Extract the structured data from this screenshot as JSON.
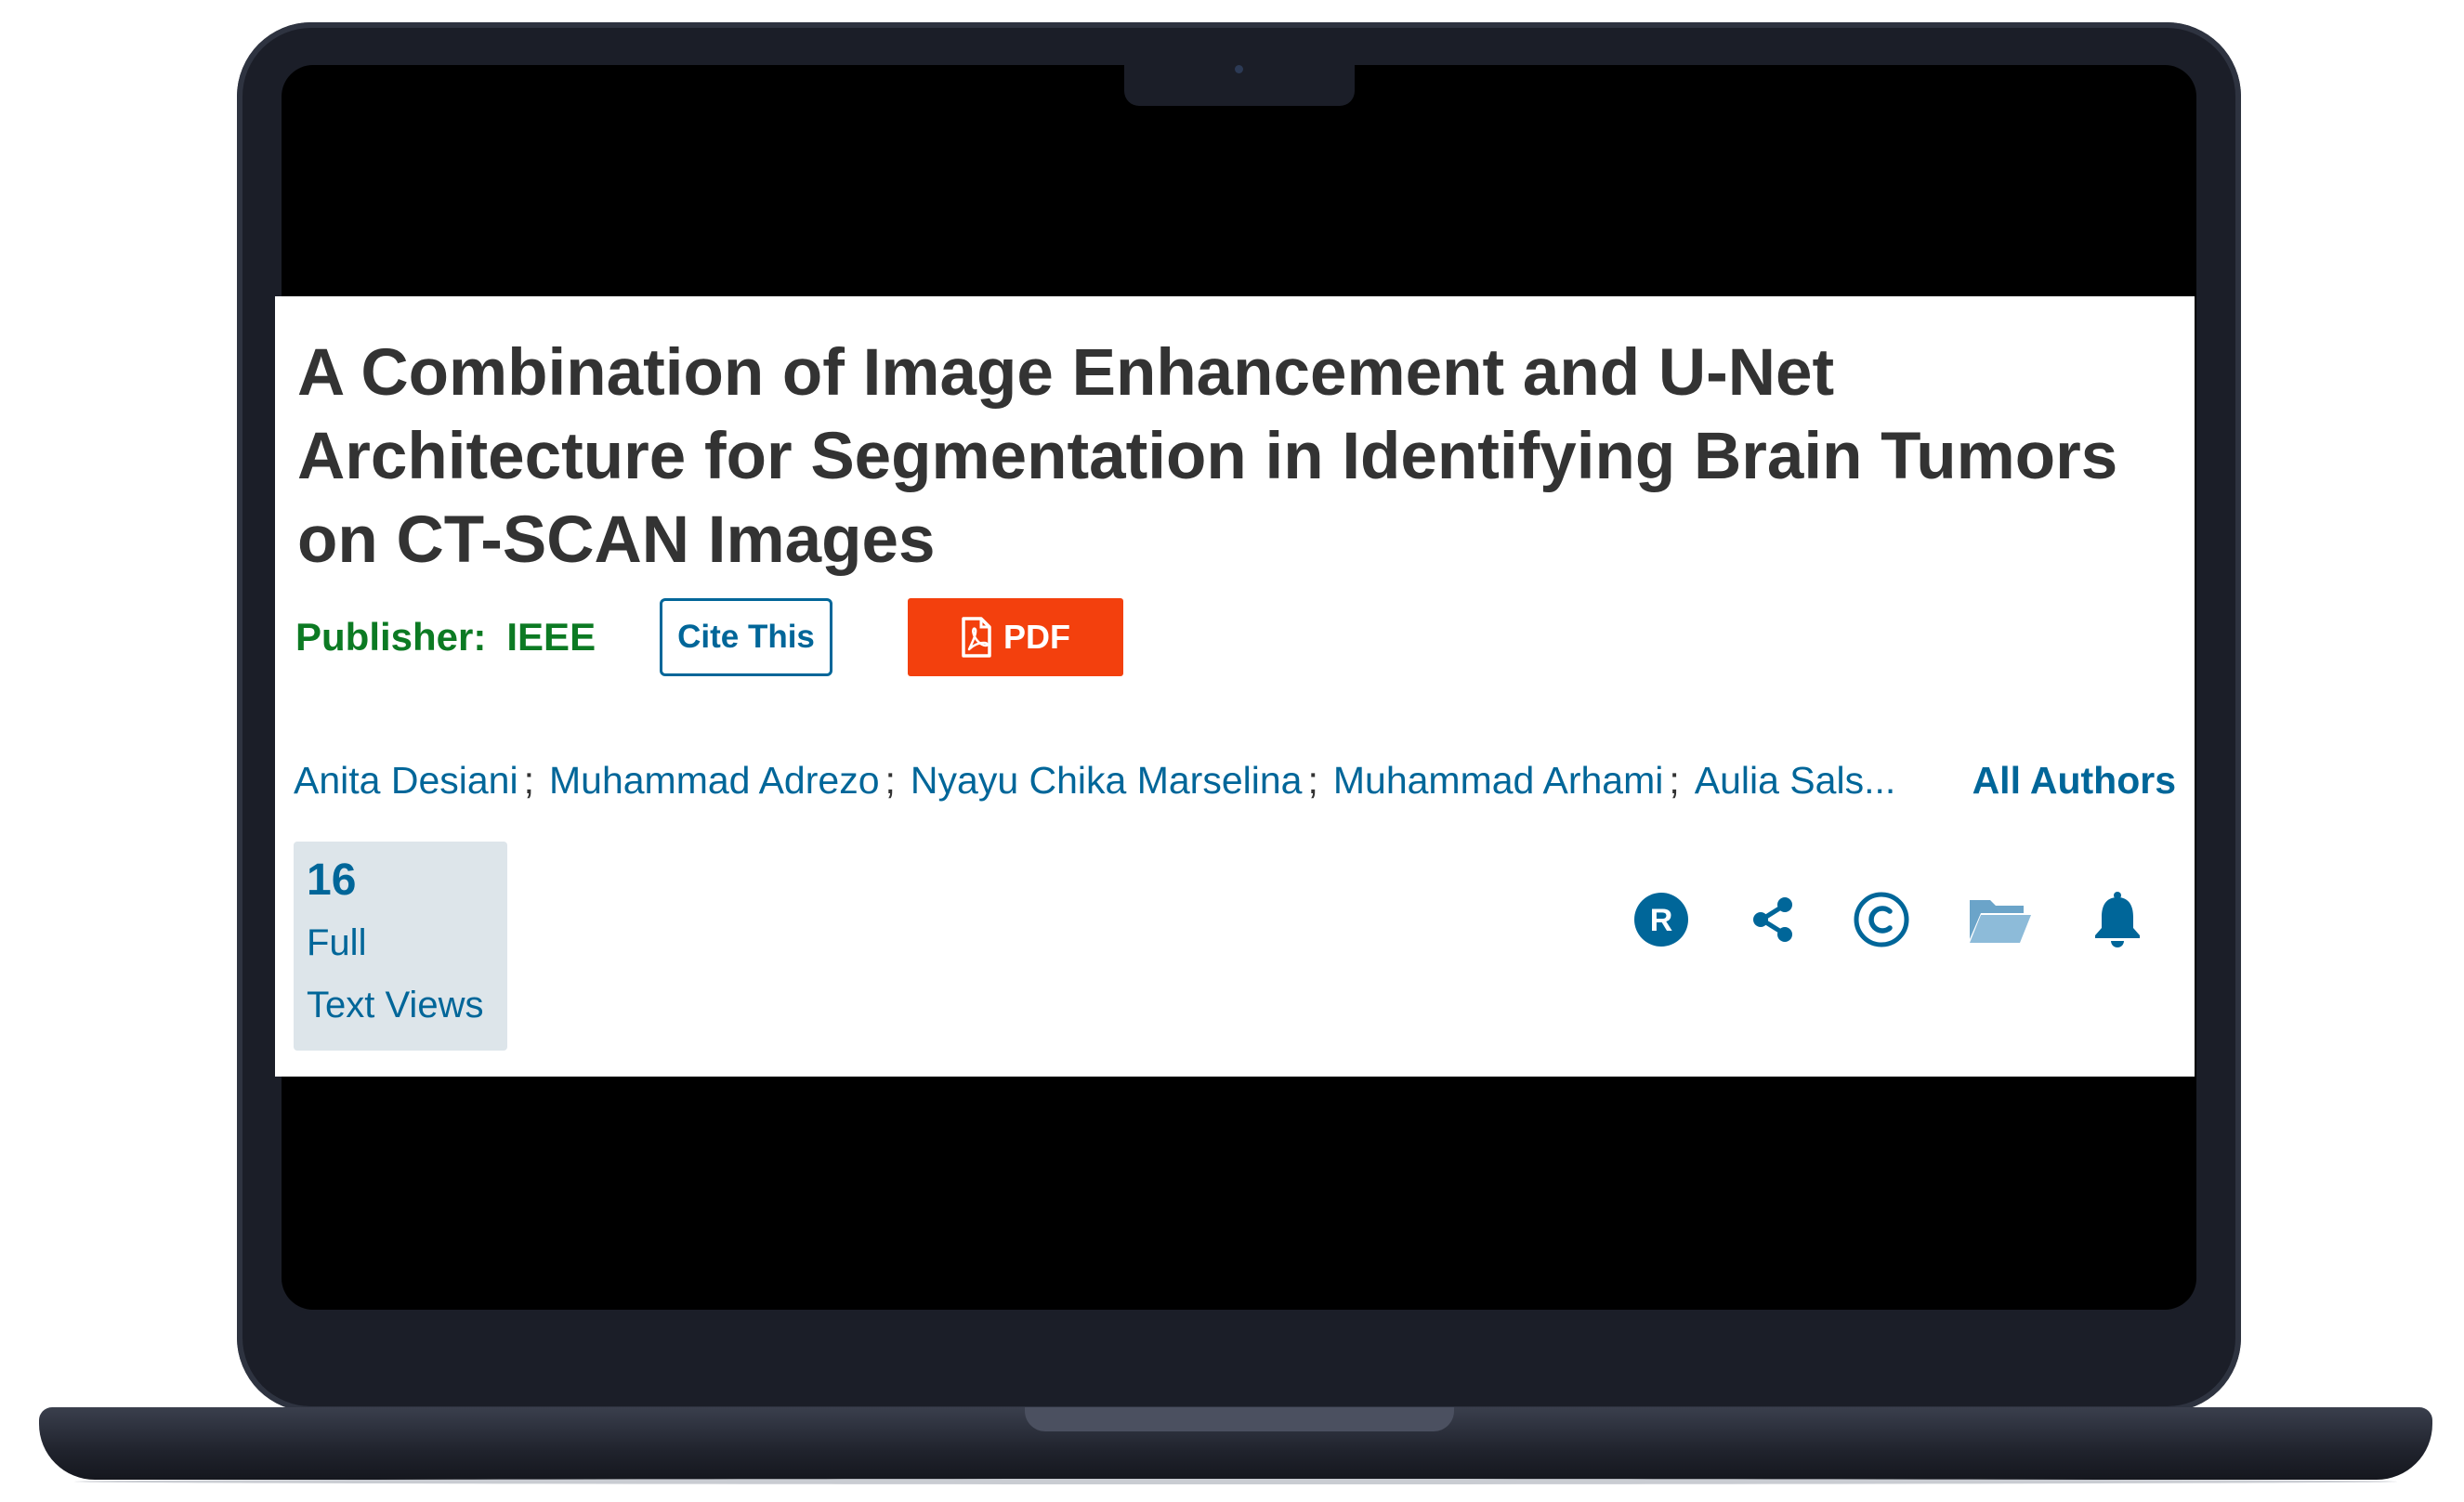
{
  "article": {
    "title": "A Combination of Image Enhancement and U-Net Architecture for Segmentation in Identifying Brain Tumors on CT-SCAN Images",
    "publisher_label": "Publisher:",
    "publisher_name": "IEEE"
  },
  "actions": {
    "cite_label": "Cite This",
    "pdf_label": "PDF"
  },
  "authors": {
    "list": [
      "Anita Desiani",
      "Muhammad Adrezo",
      "Nyayu Chika Marselina",
      "Muhammad Arhami",
      "Aulia Sals..."
    ],
    "separator": ";",
    "all_authors_label": "All Authors"
  },
  "metrics": {
    "count": "16",
    "label_line1": "Full",
    "label_line2": "Text Views"
  },
  "toolbar_icons": [
    "rights-r-icon",
    "share-icon",
    "copyright-icon",
    "folder-icon",
    "bell-icon"
  ],
  "colors": {
    "link": "#006699",
    "publisher": "#0c7a23",
    "pdf_button": "#f3400d",
    "metric_bg": "#dde5ea",
    "title": "#333333"
  }
}
